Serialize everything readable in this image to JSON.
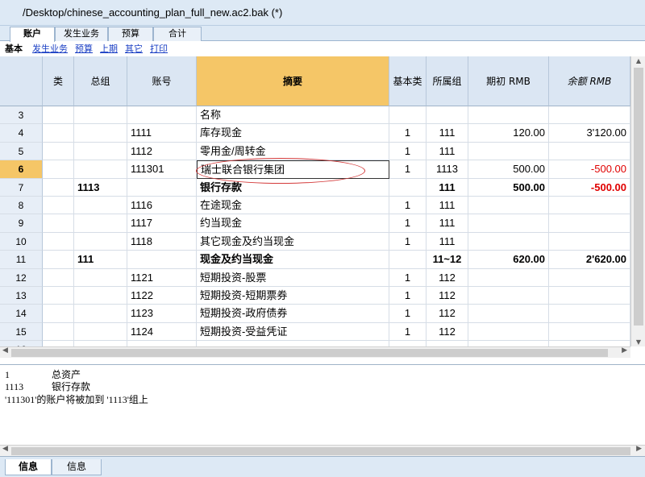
{
  "window": {
    "title": "/Desktop/chinese_accounting_plan_full_new.ac2.bak (*)"
  },
  "tabs": [
    "账户",
    "发生业务",
    "预算",
    "合计"
  ],
  "subnav": {
    "selected": "基本",
    "links": [
      "发生业务",
      "预算",
      "上期",
      "其它",
      "打印"
    ]
  },
  "columns": [
    "类",
    "总组",
    "账号",
    "摘要",
    "基本类",
    "所属组",
    "期初 RMB",
    "余额 RMB"
  ],
  "rows": [
    {
      "n": "3",
      "cls": "",
      "grp": "",
      "acct": "",
      "desc": "名称",
      "base": "",
      "belong": "",
      "open": "",
      "bal": ""
    },
    {
      "n": "4",
      "cls": "",
      "grp": "",
      "acct": "1111",
      "desc": "库存现金",
      "base": "1",
      "belong": "111",
      "open": "120.00",
      "bal": "3'120.00"
    },
    {
      "n": "5",
      "cls": "",
      "grp": "",
      "acct": "1112",
      "desc": "零用金/周转金",
      "base": "1",
      "belong": "111",
      "open": "",
      "bal": ""
    },
    {
      "n": "6",
      "cls": "",
      "grp": "",
      "acct": "111301",
      "desc": "瑞士联合银行集团",
      "base": "1",
      "belong": "1113",
      "open": "500.00",
      "bal": "-500.00"
    },
    {
      "n": "7",
      "cls": "",
      "grp": "1113",
      "acct": "",
      "desc": "银行存款",
      "base": "",
      "belong": "111",
      "open": "500.00",
      "bal": "-500.00"
    },
    {
      "n": "8",
      "cls": "",
      "grp": "",
      "acct": "1116",
      "desc": "在途现金",
      "base": "1",
      "belong": "111",
      "open": "",
      "bal": ""
    },
    {
      "n": "9",
      "cls": "",
      "grp": "",
      "acct": "1117",
      "desc": "约当现金",
      "base": "1",
      "belong": "111",
      "open": "",
      "bal": ""
    },
    {
      "n": "10",
      "cls": "",
      "grp": "",
      "acct": "1118",
      "desc": "其它现金及约当现金",
      "base": "1",
      "belong": "111",
      "open": "",
      "bal": ""
    },
    {
      "n": "11",
      "cls": "",
      "grp": "111",
      "acct": "",
      "desc": "现金及约当现金",
      "base": "",
      "belong": "11~12",
      "open": "620.00",
      "bal": "2'620.00"
    },
    {
      "n": "12",
      "cls": "",
      "grp": "",
      "acct": "1121",
      "desc": "短期投资-股票",
      "base": "1",
      "belong": "112",
      "open": "",
      "bal": ""
    },
    {
      "n": "13",
      "cls": "",
      "grp": "",
      "acct": "1122",
      "desc": "短期投资-短期票券",
      "base": "1",
      "belong": "112",
      "open": "",
      "bal": ""
    },
    {
      "n": "14",
      "cls": "",
      "grp": "",
      "acct": "1123",
      "desc": "短期投资-政府债券",
      "base": "1",
      "belong": "112",
      "open": "",
      "bal": ""
    },
    {
      "n": "15",
      "cls": "",
      "grp": "",
      "acct": "1124",
      "desc": "短期投资-受益凭证",
      "base": "1",
      "belong": "112",
      "open": "",
      "bal": ""
    },
    {
      "n": "16",
      "cls": "",
      "grp": "",
      "acct": "",
      "desc": "",
      "base": "",
      "belong": "",
      "open": "",
      "bal": ""
    }
  ],
  "messages": [
    {
      "a": "1",
      "b": "总资产"
    },
    {
      "a": "1113",
      "b": "银行存款"
    },
    {
      "a": "'111301'的账户将被加到 '1113'组上",
      "b": ""
    }
  ],
  "bottom_tabs": [
    "信息",
    "信息"
  ],
  "colors": {
    "accent": "#f5c667",
    "negative": "#e00000",
    "link": "#1a3fc4",
    "annotation": "#d43a3a"
  }
}
